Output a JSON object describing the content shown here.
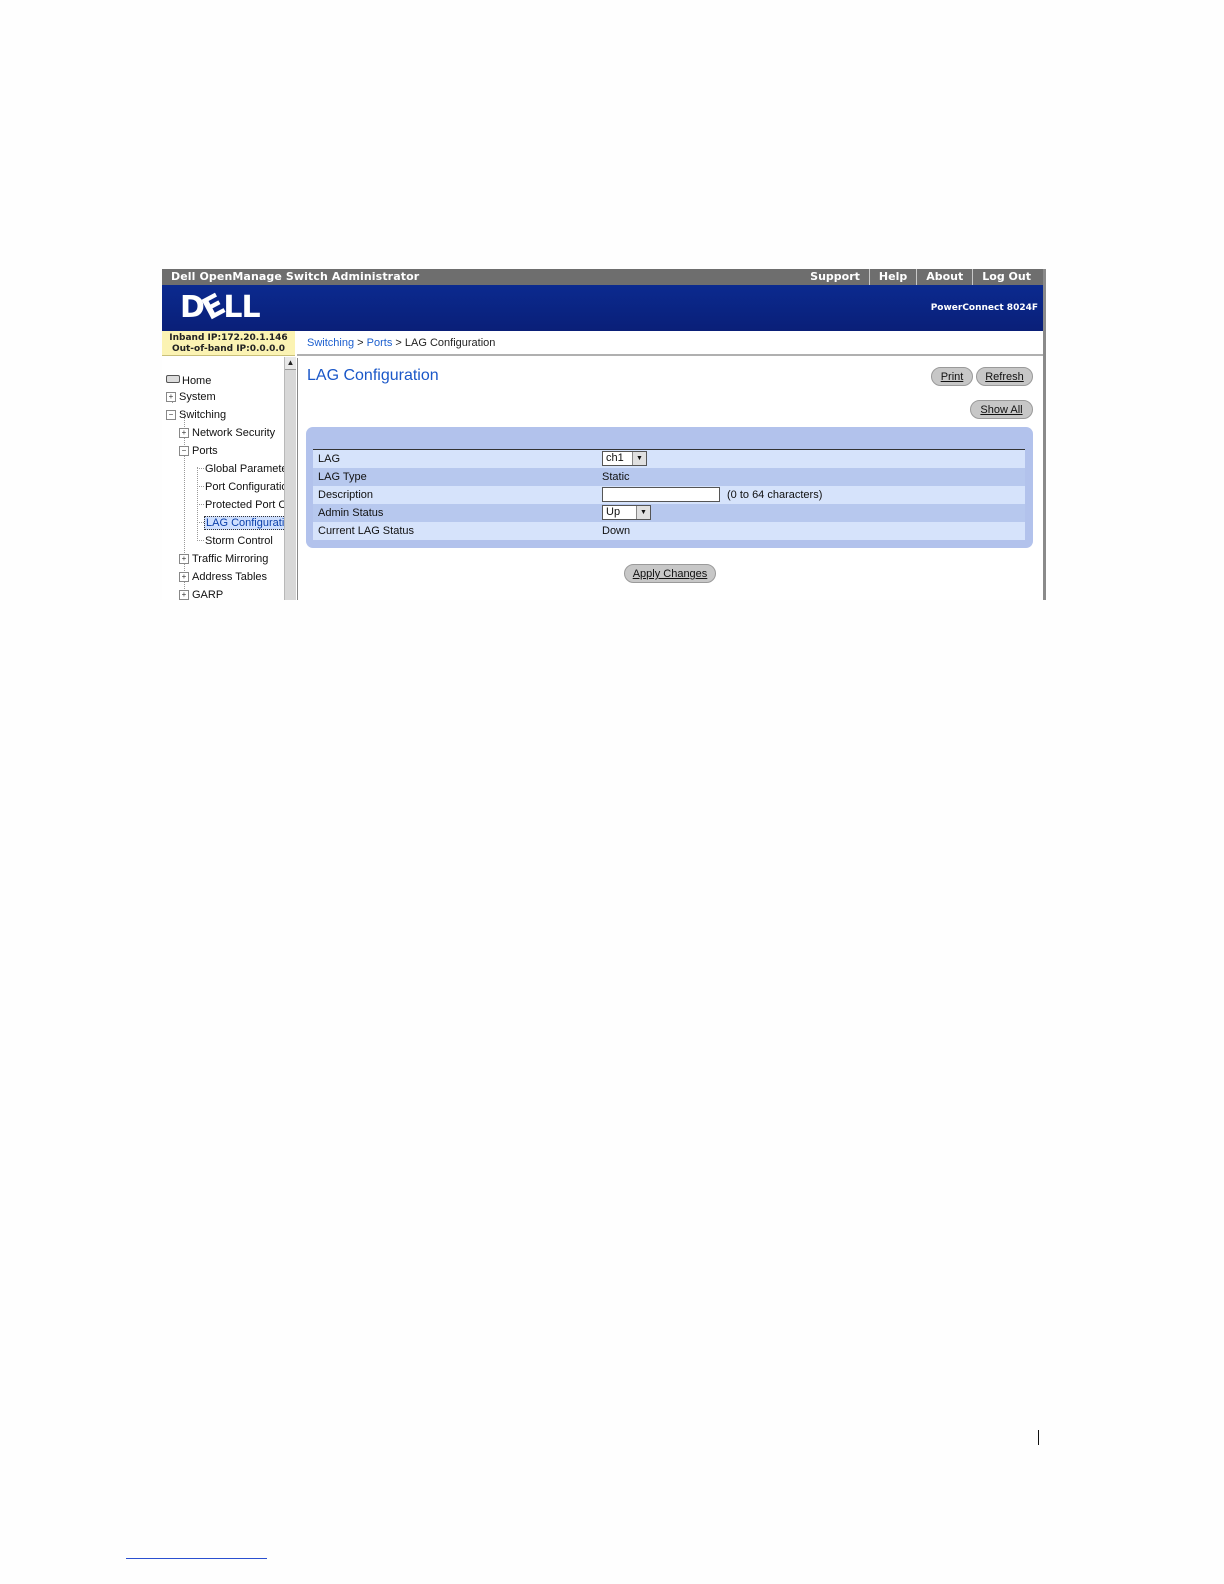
{
  "app": {
    "title": "Dell OpenManage Switch Administrator",
    "top_links": [
      "Support",
      "Help",
      "About",
      "Log Out"
    ],
    "logo_text": "DELL",
    "product": "PowerConnect 8024F",
    "inband_ip": "Inband IP:172.20.1.146",
    "oob_ip": "Out-of-band IP:0.0.0.0"
  },
  "breadcrumb": {
    "level1": "Switching",
    "sep": ">",
    "level2": "Ports",
    "current": "LAG Configuration"
  },
  "tree": {
    "home": "Home",
    "system": "System",
    "switching": "Switching",
    "network_security": "Network Security",
    "ports": "Ports",
    "global_params": "Global Paramete",
    "port_config": "Port Configuratio",
    "protected_port": "Protected Port C",
    "lag_config": "LAG Configuratio",
    "storm_control": "Storm Control",
    "traffic_mirroring": "Traffic Mirroring",
    "address_tables": "Address Tables",
    "garp": "GARP"
  },
  "main": {
    "heading": "LAG Configuration",
    "print": "Print",
    "refresh": "Refresh",
    "show_all": "Show All",
    "apply": "Apply Changes"
  },
  "form": {
    "lag_label": "LAG",
    "lag_value": "ch1",
    "lag_type_label": "LAG Type",
    "lag_type_value": "Static",
    "description_label": "Description",
    "description_value": "",
    "description_hint": "(0 to 64 characters)",
    "admin_status_label": "Admin Status",
    "admin_status_value": "Up",
    "current_status_label": "Current LAG Status",
    "current_status_value": "Down"
  }
}
